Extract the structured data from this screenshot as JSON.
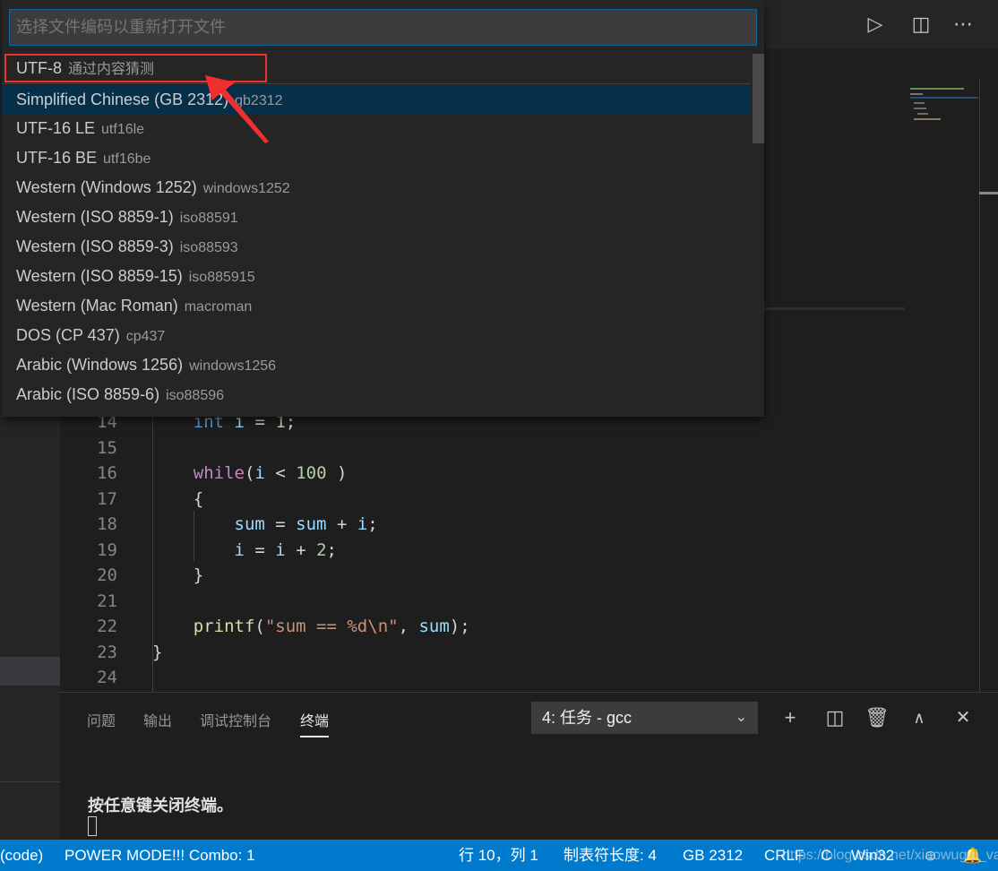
{
  "quick_pick": {
    "placeholder": "选择文件编码以重新打开文件",
    "items": [
      {
        "label": "UTF-8",
        "desc": "通过内容猜测"
      },
      {
        "label": "Simplified Chinese (GB 2312)",
        "desc": "gb2312"
      },
      {
        "label": "UTF-16 LE",
        "desc": "utf16le"
      },
      {
        "label": "UTF-16 BE",
        "desc": "utf16be"
      },
      {
        "label": "Western (Windows 1252)",
        "desc": "windows1252"
      },
      {
        "label": "Western (ISO 8859-1)",
        "desc": "iso88591"
      },
      {
        "label": "Western (ISO 8859-3)",
        "desc": "iso88593"
      },
      {
        "label": "Western (ISO 8859-15)",
        "desc": "iso885915"
      },
      {
        "label": "Western (Mac Roman)",
        "desc": "macroman"
      },
      {
        "label": "DOS (CP 437)",
        "desc": "cp437"
      },
      {
        "label": "Arabic (Windows 1256)",
        "desc": "windows1256"
      },
      {
        "label": "Arabic (ISO 8859-6)",
        "desc": "iso88596"
      }
    ],
    "active_index": 1,
    "highlight_color": "#f03030"
  },
  "titlebar": {
    "icons": [
      "run-icon",
      "split-editor-icon",
      "more-actions-icon"
    ]
  },
  "editor": {
    "lines": [
      {
        "n": "14",
        "tokens": [
          [
            "    ",
            "p"
          ],
          [
            "int",
            "t"
          ],
          [
            " ",
            "p"
          ],
          [
            "i",
            "v"
          ],
          [
            " = ",
            "p"
          ],
          [
            "1",
            "n"
          ],
          [
            ";",
            "p"
          ]
        ]
      },
      {
        "n": "15",
        "tokens": []
      },
      {
        "n": "16",
        "tokens": [
          [
            "    ",
            "p"
          ],
          [
            "while",
            "k"
          ],
          [
            "(",
            "p"
          ],
          [
            "i",
            "v"
          ],
          [
            " < ",
            "p"
          ],
          [
            "100",
            "n"
          ],
          [
            " )",
            "p"
          ]
        ]
      },
      {
        "n": "17",
        "tokens": [
          [
            "    {",
            "p"
          ]
        ]
      },
      {
        "n": "18",
        "tokens": [
          [
            "        ",
            "p"
          ],
          [
            "sum",
            "v"
          ],
          [
            " = ",
            "p"
          ],
          [
            "sum",
            "v"
          ],
          [
            " + ",
            "p"
          ],
          [
            "i",
            "v"
          ],
          [
            ";",
            "p"
          ]
        ]
      },
      {
        "n": "19",
        "tokens": [
          [
            "        ",
            "p"
          ],
          [
            "i",
            "v"
          ],
          [
            " = ",
            "p"
          ],
          [
            "i",
            "v"
          ],
          [
            " + ",
            "p"
          ],
          [
            "2",
            "n"
          ],
          [
            ";",
            "p"
          ]
        ]
      },
      {
        "n": "20",
        "tokens": [
          [
            "    }",
            "p"
          ]
        ]
      },
      {
        "n": "21",
        "tokens": []
      },
      {
        "n": "22",
        "tokens": [
          [
            "    ",
            "p"
          ],
          [
            "printf",
            "f"
          ],
          [
            "(",
            "p"
          ],
          [
            "\"sum == %d\\n\"",
            "s"
          ],
          [
            ", ",
            "p"
          ],
          [
            "sum",
            "v"
          ],
          [
            ");",
            "p"
          ]
        ]
      },
      {
        "n": "23",
        "tokens": [
          [
            "}",
            "p"
          ]
        ]
      },
      {
        "n": "24",
        "tokens": []
      }
    ]
  },
  "panel": {
    "tabs": [
      {
        "label": "问题"
      },
      {
        "label": "输出"
      },
      {
        "label": "调试控制台"
      },
      {
        "label": "终端",
        "active": true
      }
    ],
    "terminal_select": "4: 任务 - gcc",
    "terminal_output": "按任意键关闭终端。"
  },
  "statusbar": {
    "left": [
      "(code)",
      "POWER MODE!!! Combo: 1"
    ],
    "position": "行 10，列 1",
    "tab_size": "制表符长度: 4",
    "encoding": "GB 2312",
    "eol": "CRLF",
    "language": "C",
    "platform": "Win32",
    "watermark": "https://blog.csdn.net/xiaowugui_va",
    "color": "#007acc"
  }
}
